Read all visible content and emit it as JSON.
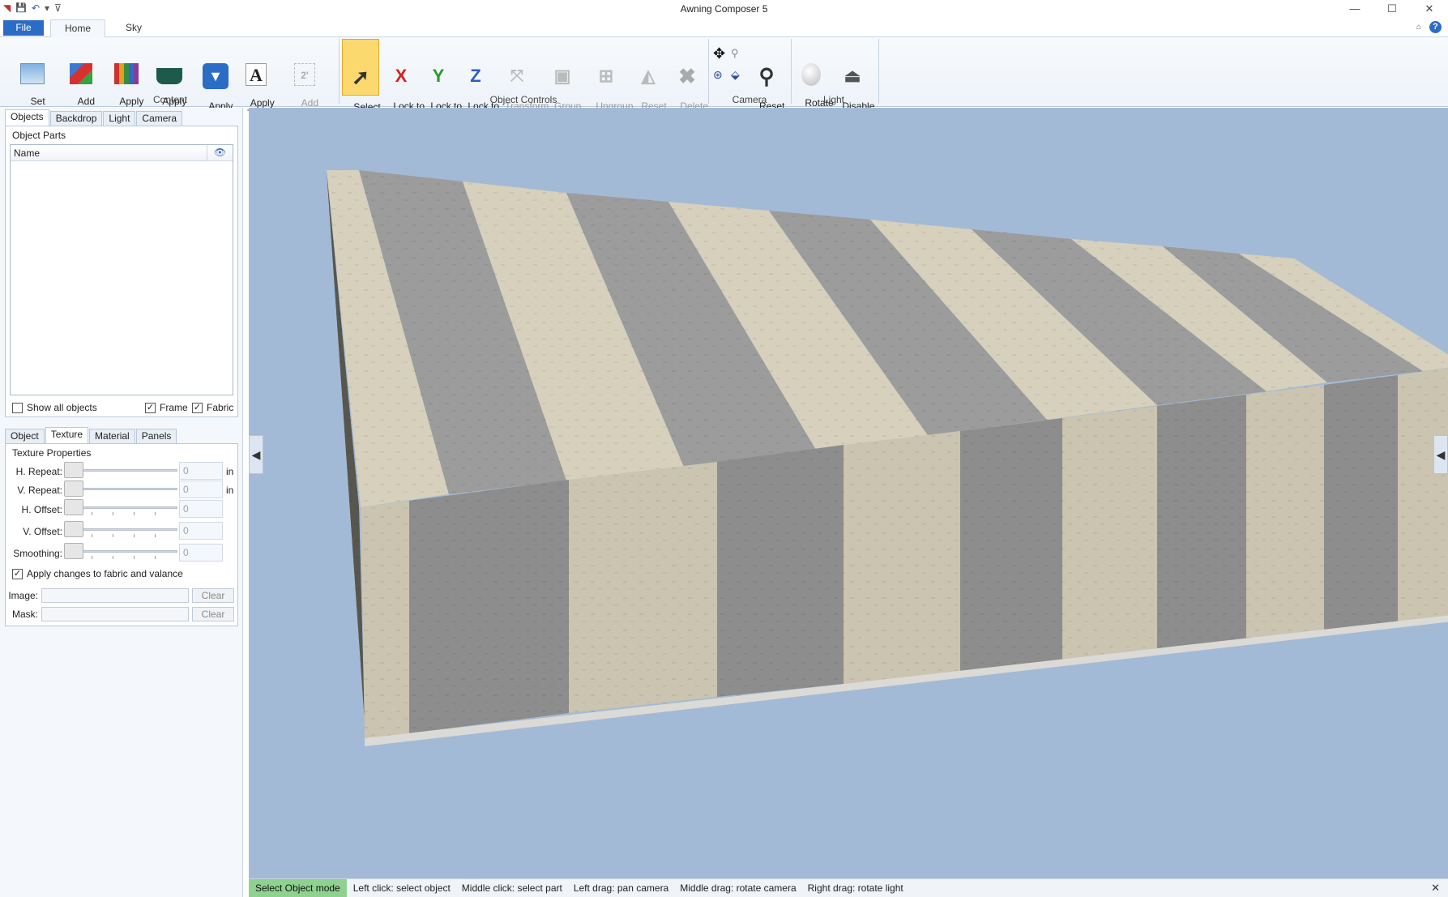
{
  "window": {
    "title": "Awning Composer 5",
    "minimize": "—",
    "maximize": "☐",
    "close": "✕"
  },
  "qat": {
    "logo": "◥",
    "save": "💾",
    "undo": "↶",
    "dropdown": "▾",
    "customize": "⊽"
  },
  "ribbon_tabs": {
    "file": "File",
    "home": "Home",
    "sky": "Sky"
  },
  "ribbon": {
    "content": {
      "group_label": "Content",
      "set_backdrop": "Set\nBackdrop ▾",
      "add_object": "Add\nObject ▾",
      "apply_material": "Apply\nMaterial",
      "apply_valance": "Apply\nValance",
      "apply_graphic": "Apply\nGraphic ▾",
      "apply_text": "Apply\nText",
      "add_dimensions": "Add\nDimensions ▾"
    },
    "object_controls": {
      "group_label": "Object Controls",
      "select_object": "Select\nObject",
      "lock_x": "Lock to\nX Axis",
      "lock_y": "Lock to\nY Axis",
      "lock_z": "Lock to\nZ Axis",
      "transform_object": "Transform\nObject ▾",
      "group_object": "Group\nObject ▾",
      "ungroup_object": "Ungroup\nObject",
      "reset_object": "Reset\nObject",
      "delete_object": "Delete\nObject"
    },
    "camera": {
      "group_label": "Camera",
      "reset_camera": "Reset\nCamera"
    },
    "light": {
      "group_label": "Light",
      "rotate_light": "Rotate\nLight",
      "disable_shadows": "Disable\nShadows"
    },
    "icons": {
      "x": "X",
      "y": "Y",
      "z": "Z",
      "text": "A",
      "dim": "2'"
    }
  },
  "top_panel": {
    "tabs": [
      "Objects",
      "Backdrop",
      "Light",
      "Camera"
    ],
    "section_title": "Object Parts",
    "column_name": "Name",
    "show_all": "Show all objects",
    "frame": "Frame",
    "fabric": "Fabric",
    "frame_checked": "✓",
    "fabric_checked": "✓"
  },
  "bottom_panel": {
    "tabs": [
      "Object",
      "Texture",
      "Material",
      "Panels"
    ],
    "section_title": "Texture Properties",
    "h_repeat": "H. Repeat:",
    "v_repeat": "V. Repeat:",
    "h_offset": "H. Offset:",
    "v_offset": "V. Offset:",
    "smoothing": "Smoothing:",
    "h_repeat_val": "0",
    "v_repeat_val": "0",
    "h_offset_val": "0",
    "v_offset_val": "0",
    "smoothing_val": "0",
    "unit": "in",
    "apply_changes": "Apply changes to fabric and valance",
    "apply_checked": "✓",
    "image": "Image:",
    "mask": "Mask:",
    "clear": "Clear"
  },
  "viewport": {
    "left_arrow": "◀",
    "right_arrow": "◀"
  },
  "status": {
    "mode": "Select Object mode",
    "hints": [
      "Left click: select object",
      "Middle click: select part",
      "Left drag: pan camera",
      "Middle drag: rotate camera",
      "Right drag: rotate light"
    ],
    "close": "✕"
  }
}
